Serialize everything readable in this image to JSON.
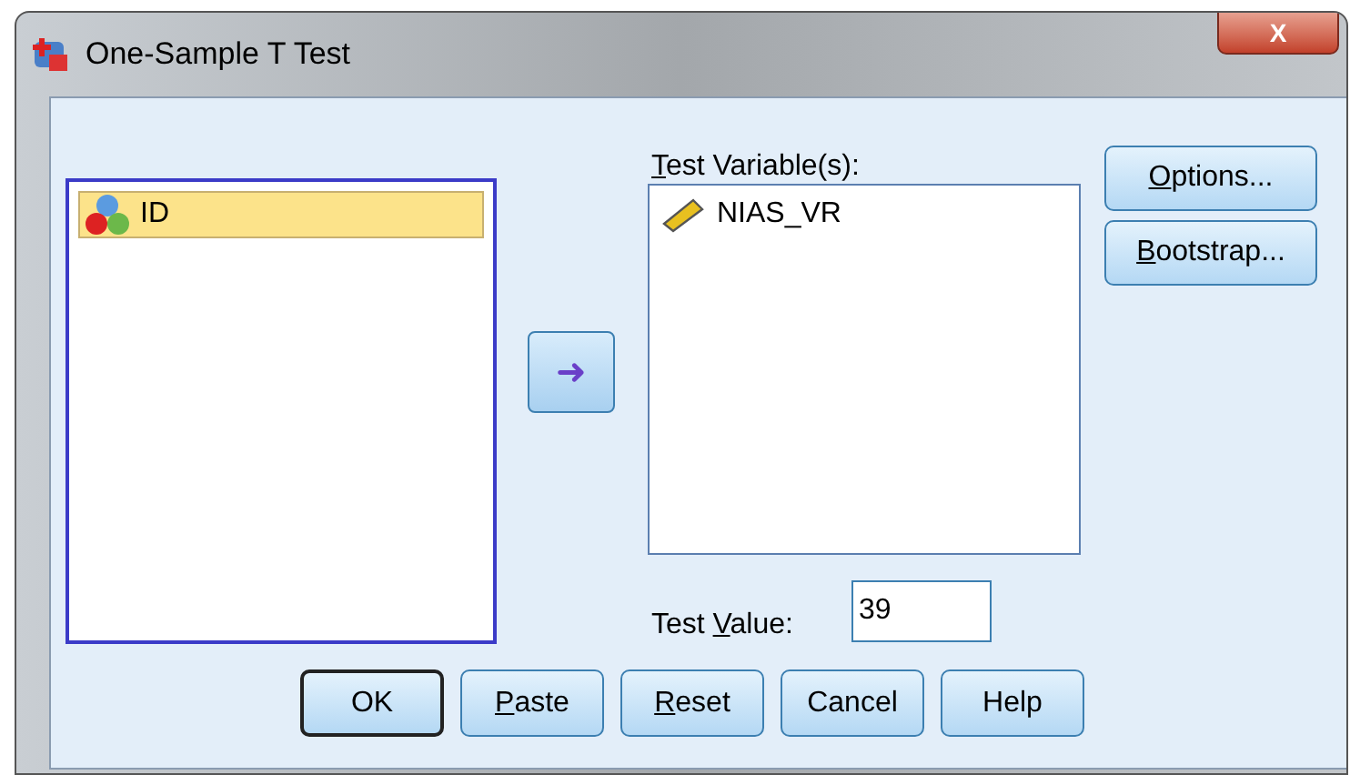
{
  "window": {
    "title": "One-Sample T Test",
    "close": "X"
  },
  "source_list": {
    "items": [
      {
        "name": "ID",
        "kind": "nominal",
        "selected": true
      }
    ]
  },
  "move_button": {
    "icon": "➜"
  },
  "target": {
    "label": {
      "key": "T",
      "after": "est Variable(s):"
    },
    "items": [
      {
        "name": "NIAS_VR",
        "kind": "scale",
        "selected": false
      }
    ]
  },
  "side_buttons": [
    {
      "label": {
        "key": "O",
        "after": "ptions..."
      }
    },
    {
      "label": {
        "key": "B",
        "after": "ootstrap..."
      }
    }
  ],
  "test_value": {
    "label": {
      "before": "Test ",
      "key": "V",
      "after": "alue:"
    },
    "value": "39"
  },
  "buttons": [
    {
      "label": {
        "before": "OK"
      },
      "default": true
    },
    {
      "label": {
        "key": "P",
        "after": "aste"
      },
      "default": false
    },
    {
      "label": {
        "key": "R",
        "after": "eset"
      },
      "default": false
    },
    {
      "label": {
        "before": "Cancel"
      },
      "default": false
    },
    {
      "label": {
        "before": "Help"
      },
      "default": false
    }
  ]
}
